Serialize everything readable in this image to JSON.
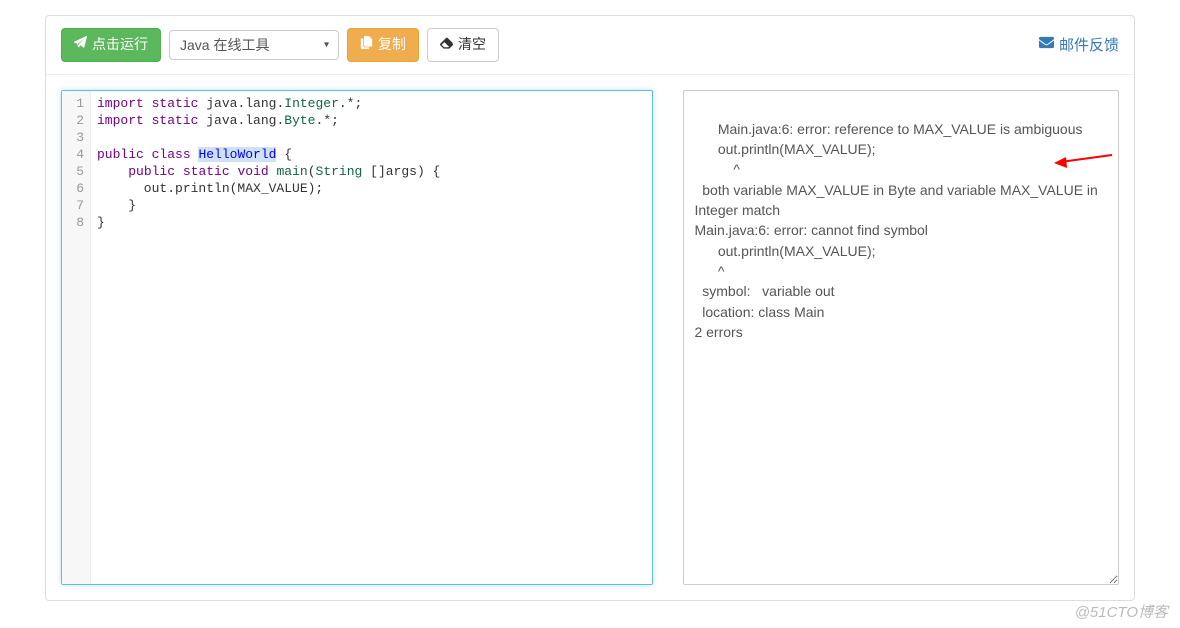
{
  "toolbar": {
    "run_label": "点击运行",
    "language_select": "Java 在线工具",
    "copy_label": "复制",
    "clear_label": "清空",
    "feedback_label": "邮件反馈"
  },
  "editor": {
    "line_numbers": [
      "1",
      "2",
      "3",
      "4",
      "5",
      "6",
      "7",
      "8"
    ],
    "tokens": [
      [
        {
          "t": "import",
          "c": "kw"
        },
        {
          "t": " "
        },
        {
          "t": "static",
          "c": "kw"
        },
        {
          "t": " java.lang."
        },
        {
          "t": "Integer",
          "c": "typ"
        },
        {
          "t": ".*;"
        }
      ],
      [
        {
          "t": "import",
          "c": "kw"
        },
        {
          "t": " "
        },
        {
          "t": "static",
          "c": "kw"
        },
        {
          "t": " java.lang."
        },
        {
          "t": "Byte",
          "c": "typ"
        },
        {
          "t": ".*;"
        }
      ],
      [],
      [
        {
          "t": "public",
          "c": "kw"
        },
        {
          "t": " "
        },
        {
          "t": "class",
          "c": "kw"
        },
        {
          "t": " "
        },
        {
          "t": "HelloWorld",
          "c": "def hl"
        },
        {
          "t": " {"
        }
      ],
      [
        {
          "t": "    "
        },
        {
          "t": "public",
          "c": "kw"
        },
        {
          "t": " "
        },
        {
          "t": "static",
          "c": "kw"
        },
        {
          "t": " "
        },
        {
          "t": "void",
          "c": "kw"
        },
        {
          "t": " "
        },
        {
          "t": "main",
          "c": "typ"
        },
        {
          "t": "("
        },
        {
          "t": "String",
          "c": "typ"
        },
        {
          "t": " []args) {"
        }
      ],
      [
        {
          "t": "      out.println(MAX_VALUE);"
        }
      ],
      [
        {
          "t": "    }"
        }
      ],
      [
        {
          "t": "}"
        }
      ]
    ]
  },
  "output": {
    "text": "Main.java:6: error: reference to MAX_VALUE is ambiguous\n      out.println(MAX_VALUE);\n          ^\n  both variable MAX_VALUE in Byte and variable MAX_VALUE in Integer match\nMain.java:6: error: cannot find symbol\n      out.println(MAX_VALUE);\n      ^\n  symbol:   variable out\n  location: class Main\n2 errors"
  },
  "watermark": "@51CTO博客"
}
